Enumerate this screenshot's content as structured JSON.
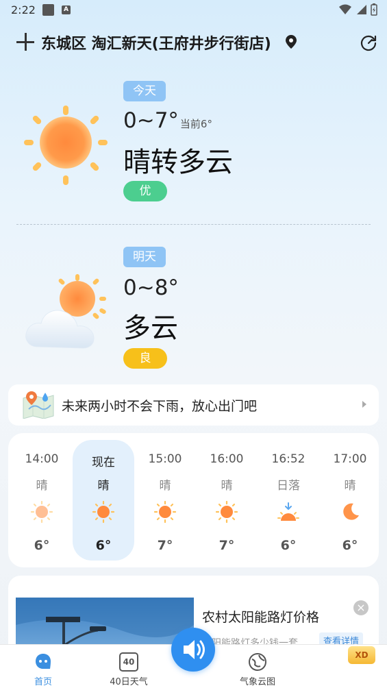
{
  "status_bar": {
    "time": "2:22"
  },
  "header": {
    "location": "东城区 淘汇新天(王府井步行街店)"
  },
  "today": {
    "tag": "今天",
    "temp_range": "0~7°",
    "current_temp": "当前6°",
    "condition": "晴转多云",
    "aqi": "优",
    "aqi_color": "#4cce8f"
  },
  "tomorrow": {
    "tag": "明天",
    "temp_range": "0~8°",
    "condition": "多云",
    "aqi": "良",
    "aqi_color": "#f7c01a"
  },
  "rain_notice": {
    "text": "未来两小时不会下雨，放心出门吧"
  },
  "hourly": [
    {
      "time": "14:00",
      "condition": "晴",
      "temp": "6°",
      "icon": "sun-icon"
    },
    {
      "time": "现在",
      "condition": "晴",
      "temp": "6°",
      "icon": "sun-icon"
    },
    {
      "time": "15:00",
      "condition": "晴",
      "temp": "7°",
      "icon": "sun-icon"
    },
    {
      "time": "16:00",
      "condition": "晴",
      "temp": "7°",
      "icon": "sun-icon"
    },
    {
      "time": "16:52",
      "condition": "日落",
      "temp": "6°",
      "icon": "sunset-icon"
    },
    {
      "time": "17:00",
      "condition": "晴",
      "temp": "6°",
      "icon": "moon-icon"
    }
  ],
  "ad": {
    "title": "农村太阳能路灯价格",
    "subtitle": "太阳能路灯多少钱一套",
    "detail": "查看详情",
    "close": "×"
  },
  "bottom_nav": {
    "home": "首页",
    "forecast40": "40日天气",
    "forecast40_icon_number": "40",
    "cloud_map": "气象云图",
    "gold_badge": "XD"
  }
}
